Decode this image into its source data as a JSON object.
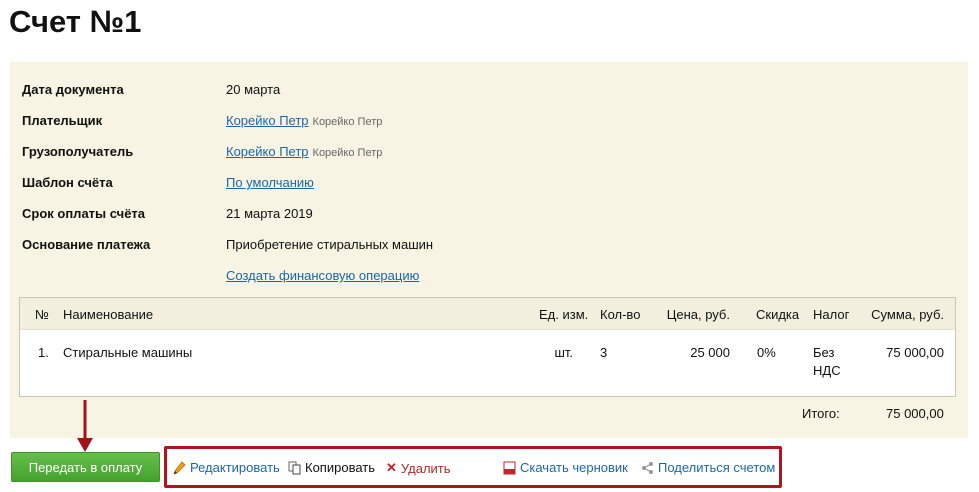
{
  "page": {
    "title": "Счет №1"
  },
  "fields": [
    {
      "label": "Дата документа",
      "value": "20 марта"
    },
    {
      "label": "Плательщик",
      "link": "Корейко Петр",
      "sub": "Корейко Петр"
    },
    {
      "label": "Грузополучатель",
      "link": "Корейко Петр",
      "sub": "Корейко Петр"
    },
    {
      "label": "Шаблон счёта",
      "link": "По умолчанию"
    },
    {
      "label": "Срок оплаты счёта",
      "value": "21 марта 2019"
    },
    {
      "label": "Основание платежа",
      "value": "Приобретение стиральных машин"
    }
  ],
  "create_operation_link": "Создать финансовую операцию",
  "table": {
    "headers": {
      "num": "№",
      "name": "Наименование",
      "unit": "Ед. изм.",
      "qty": "Кол-во",
      "price": "Цена, руб.",
      "discount": "Скидка",
      "tax": "Налог",
      "sum": "Сумма, руб."
    },
    "rows": [
      {
        "num": "1.",
        "name": "Стиральные машины",
        "unit": "шт.",
        "qty": "3",
        "price": "25 000",
        "discount": "0%",
        "tax_line1": "Без",
        "tax_line2": "НДС",
        "sum": "75 000,00"
      }
    ]
  },
  "totals": {
    "label": "Итого:",
    "value": "75 000,00"
  },
  "pay_button": "Передать в оплату",
  "actions": {
    "edit": "Редактировать",
    "copy": "Копировать",
    "delete": "Удалить",
    "download": "Скачать черновик",
    "share": "Поделиться счетом"
  },
  "colors": {
    "card_bg": "#f7f4e3",
    "link": "#1a68a7",
    "pay_button": "#52ad39",
    "highlight": "#b0141c"
  }
}
